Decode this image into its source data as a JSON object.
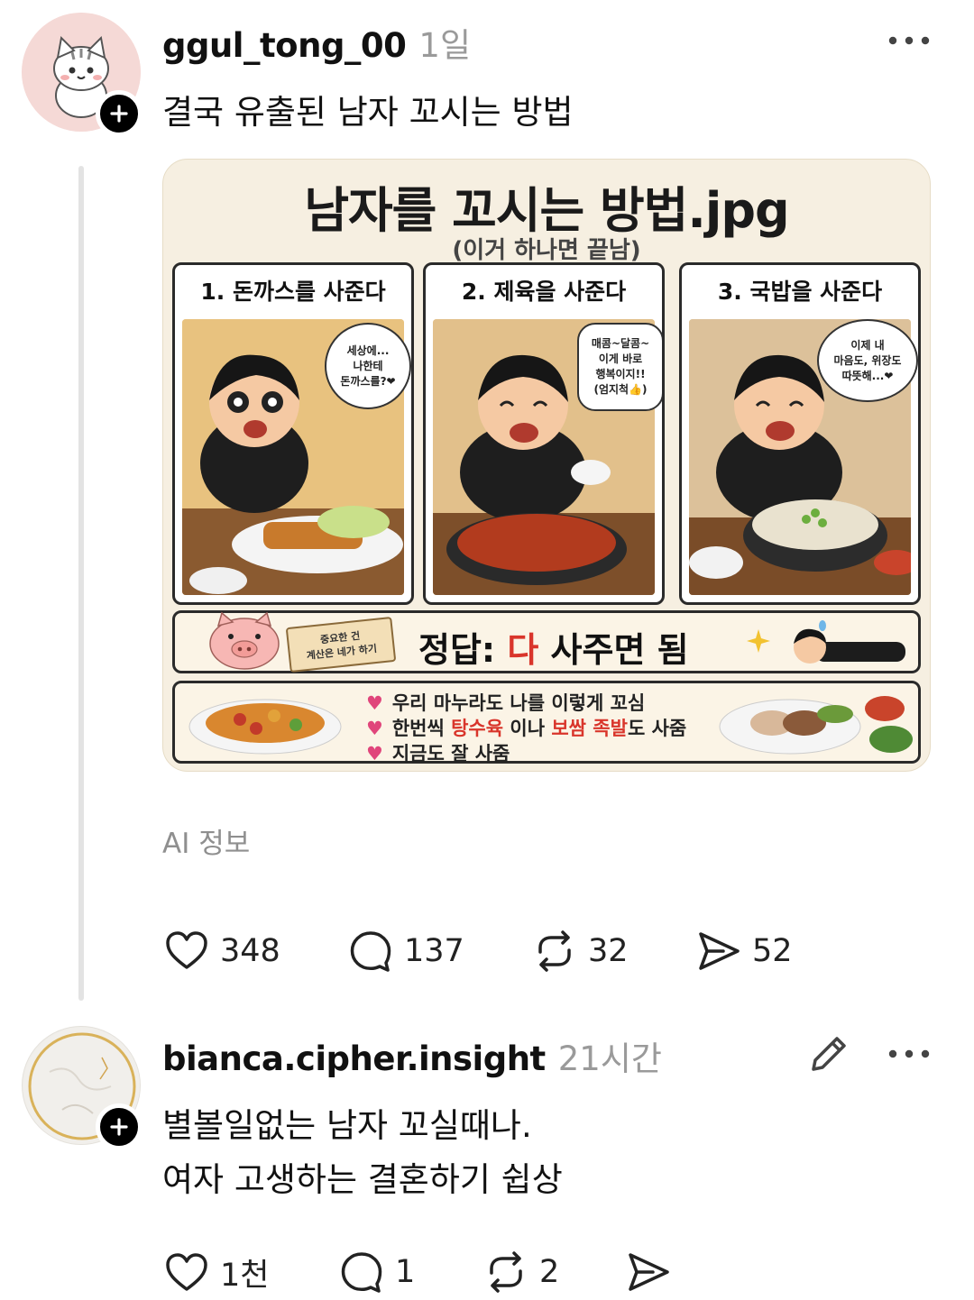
{
  "post": {
    "username": "ggul_tong_00",
    "time": "1일",
    "text": "결국 유출된 남자 꼬시는 방법",
    "ai_label": "AI 정보",
    "image": {
      "title": "남자를 꼬시는 방법.jpg",
      "subtitle": "(이거 하나면 끝남)",
      "panels": [
        {
          "title": "1. 돈까스를 사준다",
          "bubble": "세상에...\n나한테\n돈까스를?❤"
        },
        {
          "title": "2. 제육을 사준다",
          "bubble": "매콤~달콤~\n이게 바로\n행복이지!!\n(엄지척👍)"
        },
        {
          "title": "3. 국밥을 사준다",
          "bubble": "이제 내\n마음도, 위장도\n따뜻해...❤"
        }
      ],
      "sign": "중요한 건\n계산은 네가 하기",
      "answer_prefix": "정답: ",
      "answer_red": "다",
      "answer_suffix": " 사주면 됨",
      "bullets": {
        "b1": "우리 마누라도 나를 이렇게 꼬심",
        "b2_pre": "한번씩 ",
        "b2_red1": "탕수육",
        "b2_mid": " 이나 ",
        "b2_red2": "보쌈 족발",
        "b2_post": "도 사줌",
        "b3": "지금도 잘 사줌"
      }
    },
    "actions": {
      "likes": "348",
      "comments": "137",
      "reposts": "32",
      "shares": "52"
    }
  },
  "reply": {
    "username": "bianca.cipher.insight",
    "time": "21시간",
    "line1": "별볼일없는 남자 꼬실때나.",
    "line2": "여자 고생하는 결혼하기 쉽상",
    "actions": {
      "likes": "1천",
      "comments": "1",
      "reposts": "2"
    }
  },
  "icons": [
    "plus-icon",
    "more-icon",
    "heart-icon",
    "comment-icon",
    "repost-icon",
    "share-icon",
    "pencil-icon"
  ]
}
